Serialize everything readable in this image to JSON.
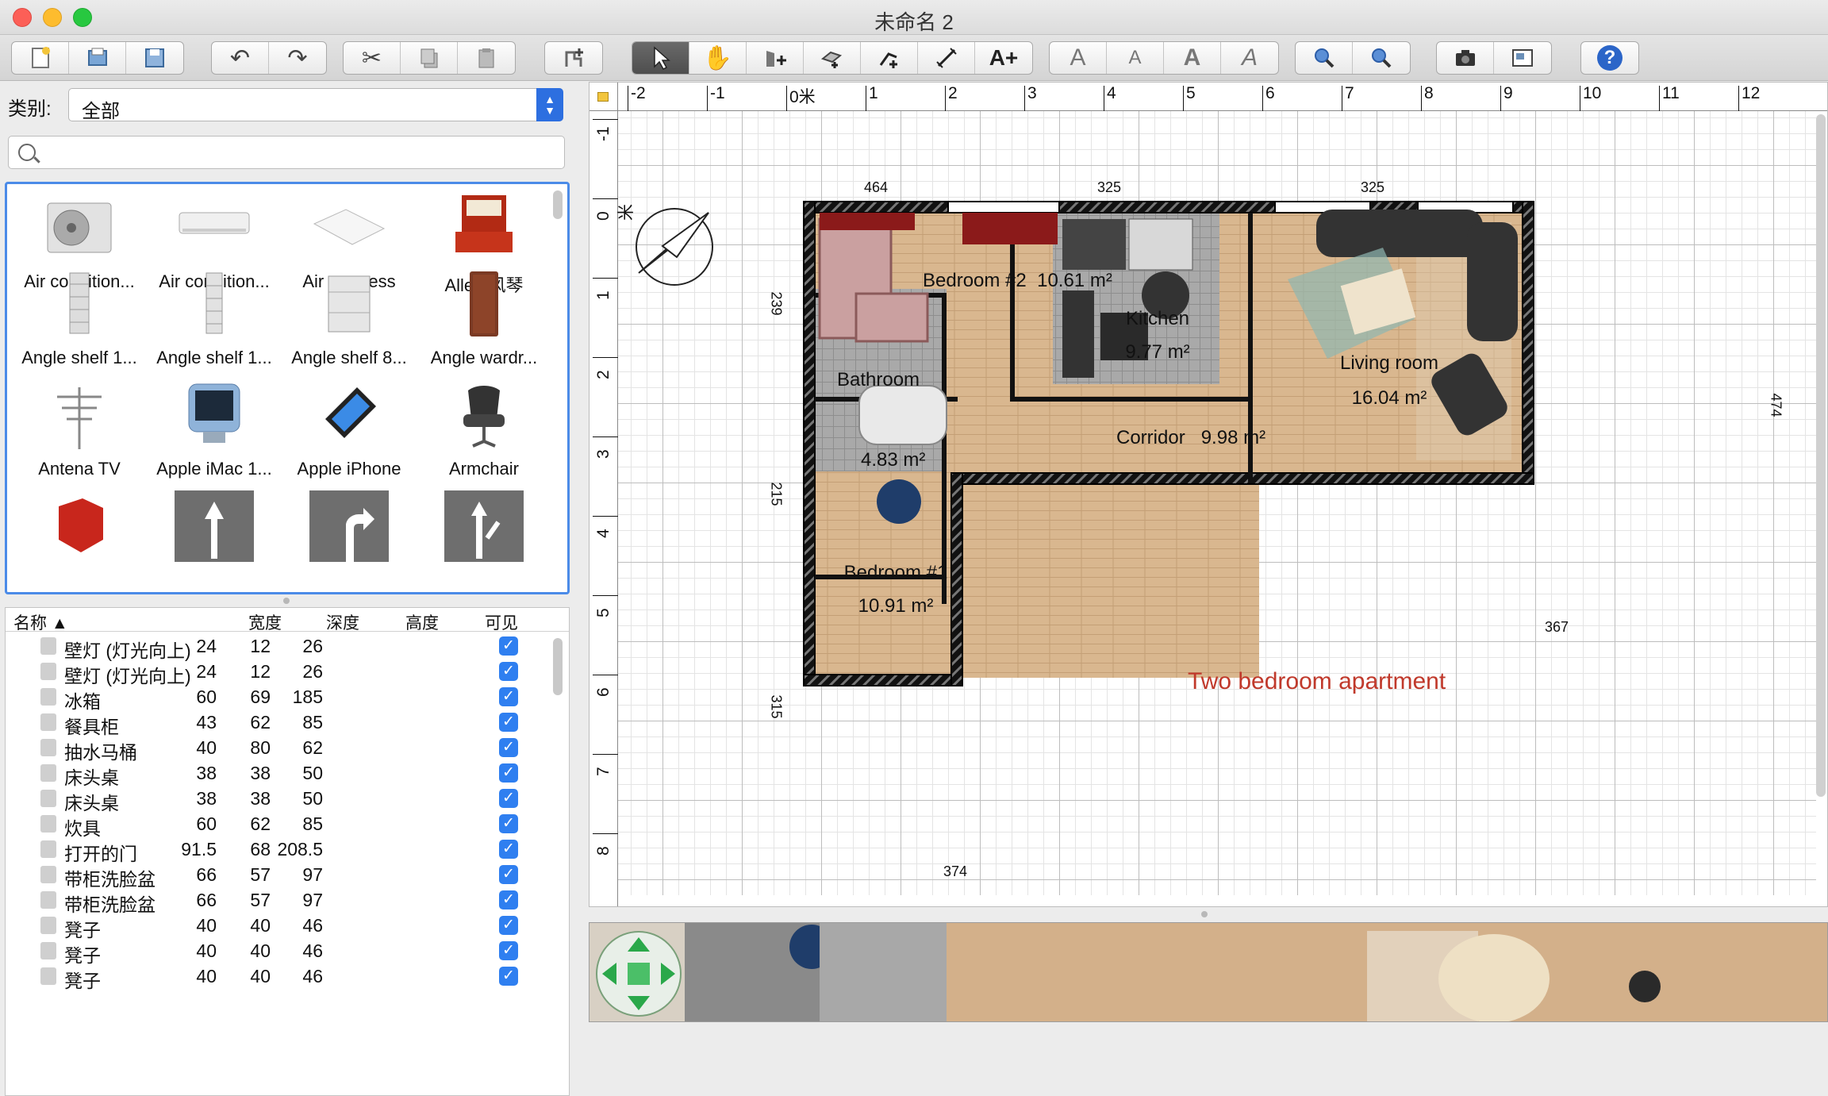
{
  "window": {
    "title": "未命名 2"
  },
  "toolbar": {
    "groups": [
      {
        "name": "file",
        "buttons": [
          "new-home-icon",
          "open-icon",
          "save-icon"
        ]
      },
      {
        "name": "history",
        "buttons": [
          "undo-icon",
          "redo-icon"
        ]
      },
      {
        "name": "clipboard",
        "buttons": [
          "cut-icon",
          "copy-icon",
          "paste-icon"
        ]
      },
      {
        "name": "furniture",
        "buttons": [
          "add-furniture-icon"
        ]
      },
      {
        "name": "modes",
        "buttons": [
          "select-arrow-icon",
          "pan-hand-icon",
          "create-walls-icon",
          "create-rooms-icon",
          "create-polylines-icon",
          "create-dimensions-icon",
          "add-text-icon"
        ]
      },
      {
        "name": "text-style",
        "buttons": [
          "increase-text-icon",
          "decrease-text-icon",
          "bold-text-icon",
          "italic-text-icon"
        ]
      },
      {
        "name": "zoom",
        "buttons": [
          "zoom-in-icon",
          "zoom-out-icon"
        ]
      },
      {
        "name": "views",
        "buttons": [
          "photo-camera-icon",
          "video-icon"
        ]
      },
      {
        "name": "help",
        "buttons": [
          "help-icon"
        ]
      }
    ]
  },
  "catalog": {
    "category_label": "类别:",
    "category_value": "全部",
    "search_placeholder": "",
    "items": [
      {
        "name": "Air condition..."
      },
      {
        "name": "Air condition..."
      },
      {
        "name": "Air mattress"
      },
      {
        "name": "Allen 风琴"
      },
      {
        "name": "Angle shelf 1..."
      },
      {
        "name": "Angle shelf 1..."
      },
      {
        "name": "Angle shelf 8..."
      },
      {
        "name": "Angle wardr..."
      },
      {
        "name": "Antena TV"
      },
      {
        "name": "Apple iMac 1..."
      },
      {
        "name": "Apple iPhone"
      },
      {
        "name": "Armchair"
      }
    ]
  },
  "furniture_table": {
    "headers": {
      "name": "名称 ▲",
      "width": "宽度",
      "depth": "深度",
      "height": "高度",
      "visible": "可见"
    },
    "rows": [
      {
        "name": "壁灯 (灯光向上)",
        "width": "24",
        "depth": "12",
        "height": "26"
      },
      {
        "name": "壁灯 (灯光向上)",
        "width": "24",
        "depth": "12",
        "height": "26"
      },
      {
        "name": "冰箱",
        "width": "60",
        "depth": "69",
        "height": "185"
      },
      {
        "name": "餐具柜",
        "width": "43",
        "depth": "62",
        "height": "85"
      },
      {
        "name": "抽水马桶",
        "width": "40",
        "depth": "80",
        "height": "62"
      },
      {
        "name": "床头桌",
        "width": "38",
        "depth": "38",
        "height": "50"
      },
      {
        "name": "床头桌",
        "width": "38",
        "depth": "38",
        "height": "50"
      },
      {
        "name": "炊具",
        "width": "60",
        "depth": "62",
        "height": "85"
      },
      {
        "name": "打开的门",
        "width": "91.5",
        "depth": "68",
        "height": "208.5"
      },
      {
        "name": "带柜洗脸盆",
        "width": "66",
        "depth": "57",
        "height": "97"
      },
      {
        "name": "带柜洗脸盆",
        "width": "66",
        "depth": "57",
        "height": "97"
      },
      {
        "name": "凳子",
        "width": "40",
        "depth": "40",
        "height": "46"
      },
      {
        "name": "凳子",
        "width": "40",
        "depth": "40",
        "height": "46"
      },
      {
        "name": "凳子",
        "width": "40",
        "depth": "40",
        "height": "46"
      }
    ]
  },
  "plan": {
    "h_ruler": [
      "-2",
      "-1",
      "0米",
      "1",
      "2",
      "3",
      "4",
      "5",
      "6",
      "7",
      "8",
      "9",
      "10",
      "11",
      "12"
    ],
    "v_ruler": [
      "-1",
      "0米",
      "1",
      "2",
      "3",
      "4",
      "5",
      "6",
      "7",
      "8"
    ],
    "rooms": {
      "bedroom2": {
        "name": "Bedroom #2",
        "area": "10.61 m²"
      },
      "kitchen": {
        "name": "Kitchen",
        "area": "9.77 m²"
      },
      "living": {
        "name": "Living room",
        "area": "16.04 m²"
      },
      "bathroom": {
        "name": "Bathroom",
        "area": "4.83 m²"
      },
      "corridor": {
        "name": "Corridor",
        "area": "9.98 m²"
      },
      "bedroom1": {
        "name": "Bedroom #1",
        "area": "10.91 m²"
      }
    },
    "dimensions": {
      "top_a": "464",
      "top_b": "325",
      "top_c": "325",
      "left_a": "239",
      "left_b": "215",
      "left_c": "315",
      "right": "474",
      "bottom_right": "367",
      "bottom": "374"
    },
    "title": "Two bedroom apartment"
  },
  "colors": {
    "accent": "#2f7ff0",
    "wall": "#111111",
    "wood_floor": "#d7b48c",
    "tile_floor": "#a8a8a8",
    "title_text": "#c0392b"
  }
}
